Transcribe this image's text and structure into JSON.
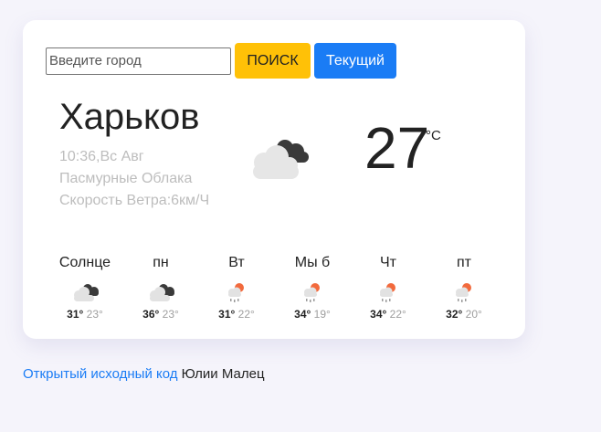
{
  "search": {
    "placeholder": "Введите город",
    "value": "",
    "search_button": "ПОИСК",
    "current_button": "Текущий"
  },
  "current": {
    "city": "Харьков",
    "datetime": "10:36,Вс Авг",
    "description": "Пасмурные Облака",
    "wind": "Скорость Ветра:6км/Ч",
    "temperature": "27",
    "unit": "°C",
    "icon": "overcast-clouds-icon"
  },
  "forecast": [
    {
      "day": "Солнце",
      "hi": "31°",
      "lo": "23°",
      "icon": "overcast-clouds-icon"
    },
    {
      "day": "пн",
      "hi": "36°",
      "lo": "23°",
      "icon": "overcast-clouds-icon"
    },
    {
      "day": "Вт",
      "hi": "31°",
      "lo": "22°",
      "icon": "sun-rain-icon"
    },
    {
      "day": "Мы б",
      "hi": "34°",
      "lo": "19°",
      "icon": "sun-rain-icon"
    },
    {
      "day": "Чт",
      "hi": "34°",
      "lo": "22°",
      "icon": "sun-rain-icon"
    },
    {
      "day": "пт",
      "hi": "32°",
      "lo": "20°",
      "icon": "sun-rain-icon"
    }
  ],
  "footer": {
    "link_text": "Открытый исходный код",
    "author": " Юлии Малец"
  },
  "colors": {
    "search_button": "#ffc107",
    "current_button": "#1a7cf5",
    "link": "#1a7cf5",
    "muted_text": "#bdbdbd",
    "background": "#f5f4fb"
  }
}
